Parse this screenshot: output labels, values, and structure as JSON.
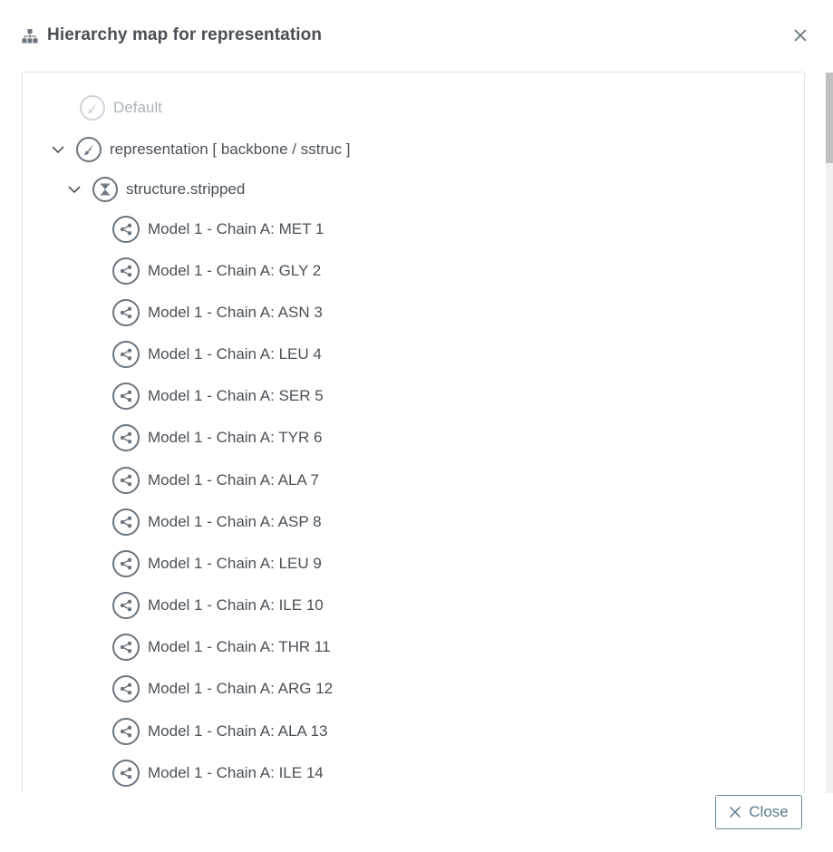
{
  "dialog": {
    "title": "Hierarchy map for representation",
    "title_icon": "sitemap-icon",
    "close_icon": "close-icon"
  },
  "tree": {
    "default_label": "Default",
    "representation_label": "representation [ backbone / sstruc ]",
    "structure_label": "structure.stripped",
    "selections": [
      "Model 1 - Chain A: MET 1",
      "Model 1 - Chain A: GLY 2",
      "Model 1 - Chain A: ASN 3",
      "Model 1 - Chain A: LEU 4",
      "Model 1 - Chain A: SER 5",
      "Model 1 - Chain A: TYR 6",
      "Model 1 - Chain A: ALA 7",
      "Model 1 - Chain A: ASP 8",
      "Model 1 - Chain A: LEU 9",
      "Model 1 - Chain A: ILE 10",
      "Model 1 - Chain A: THR 11",
      "Model 1 - Chain A: ARG 12",
      "Model 1 - Chain A: ALA 13",
      "Model 1 - Chain A: ILE 14"
    ]
  },
  "footer": {
    "close_label": "Close"
  },
  "colors": {
    "text": "#495057",
    "icon_border": "#6c757d",
    "disabled": "#adb5bd",
    "button": "#5a7a8c"
  }
}
